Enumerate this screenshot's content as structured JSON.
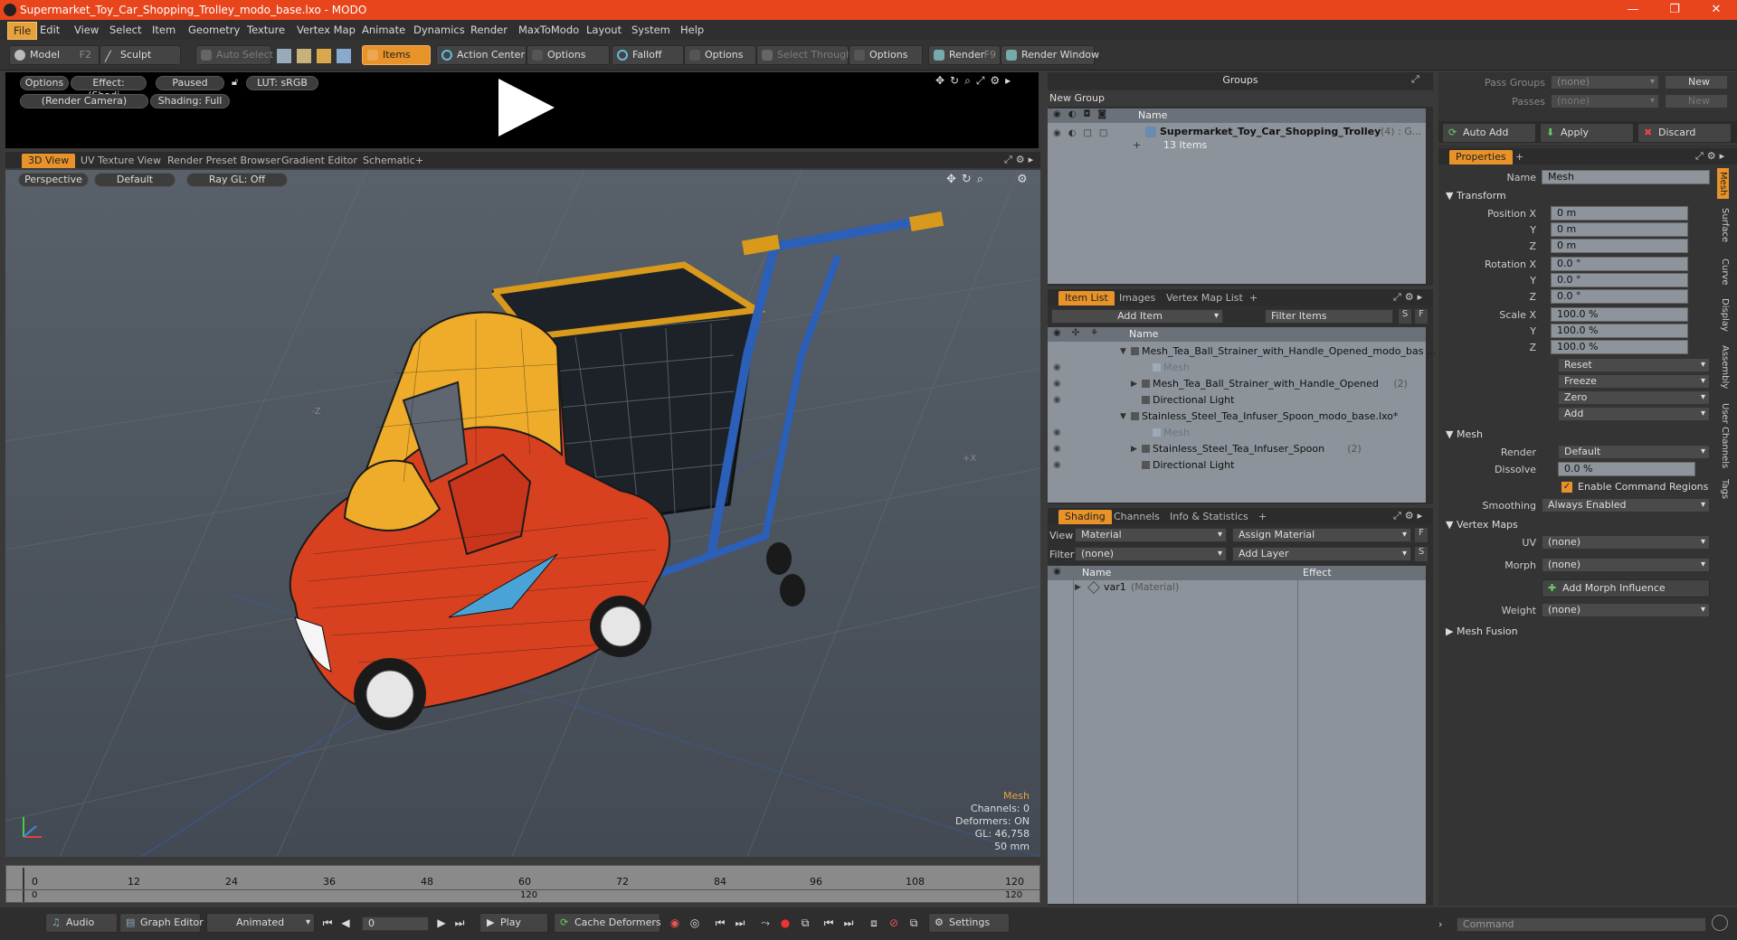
{
  "window": {
    "title": "Supermarket_Toy_Car_Shopping_Trolley_modo_base.lxo - MODO"
  },
  "menu": [
    "File",
    "Edit",
    "View",
    "Select",
    "Item",
    "Geometry",
    "Texture",
    "Vertex Map",
    "Animate",
    "Dynamics",
    "Render",
    "MaxToModo",
    "Layout",
    "System",
    "Help"
  ],
  "toolbar": {
    "model": "Model",
    "model_key": "F2",
    "sculpt": "Sculpt",
    "auto_select": "Auto Select",
    "items": "Items",
    "action_center": "Action Center",
    "options1": "Options",
    "falloff": "Falloff",
    "options2": "Options",
    "select_through": "Select Through",
    "options3": "Options",
    "render": "Render",
    "render_key": "F9",
    "render_window": "Render Window"
  },
  "preview": {
    "options": "Options",
    "effect": "Effect: (Shadi...",
    "paused": "Paused",
    "lut": "LUT: sRGB",
    "camera": "(Render Camera)",
    "shading": "Shading: Full"
  },
  "viewtabs": [
    "3D View",
    "UV Texture View",
    "Render Preset Browser",
    "Gradient Editor",
    "Schematic",
    "+"
  ],
  "viewport": {
    "perspective": "Perspective",
    "default": "Default",
    "raygl": "Ray GL: Off",
    "axis_z": "-Z",
    "axis_x": "+X",
    "info": {
      "mesh": "Mesh",
      "channels": "Channels: 0",
      "deformers": "Deformers: ON",
      "gl": "GL: 46,758",
      "size": "50 mm"
    }
  },
  "timeline": {
    "labels": [
      "0",
      "12",
      "24",
      "36",
      "48",
      "60",
      "72",
      "84",
      "96",
      "108",
      "120"
    ],
    "bottom_left": "0",
    "bottom_mid": "120",
    "bottom_right": "120"
  },
  "statusbar": {
    "audio": "Audio",
    "graph_editor": "Graph Editor",
    "animated": "Animated",
    "frame": "0",
    "play": "Play",
    "cache": "Cache Deformers",
    "settings": "Settings",
    "command": "Command"
  },
  "groups": {
    "title": "Groups",
    "new_group": "New Group",
    "col_name": "Name",
    "item_name": "Supermarket_Toy_Car_Shopping_Trolley",
    "item_count": "(4) : G...",
    "item_sub": "13 Items"
  },
  "itemlist": {
    "tabs": [
      "Item List",
      "Images",
      "Vertex Map List",
      "+"
    ],
    "add_item": "Add Item",
    "filter": "Filter Items",
    "col_name": "Name",
    "rows": [
      {
        "text": "Mesh_Tea_Ball_Strainer_with_Handle_Opened_modo_bas ...",
        "indent": 0,
        "arrow": "▼",
        "dim": false
      },
      {
        "text": "Mesh",
        "indent": 2,
        "arrow": "",
        "dim": true
      },
      {
        "text": "Mesh_Tea_Ball_Strainer_with_Handle_Opened",
        "extra": "(2)",
        "indent": 1,
        "arrow": "▶",
        "dim": false
      },
      {
        "text": "Directional Light",
        "indent": 1,
        "arrow": "",
        "dim": false
      },
      {
        "text": "Stainless_Steel_Tea_Infuser_Spoon_modo_base.lxo*",
        "indent": 0,
        "arrow": "▼",
        "dim": false
      },
      {
        "text": "Mesh",
        "indent": 2,
        "arrow": "",
        "dim": true
      },
      {
        "text": "Stainless_Steel_Tea_Infuser_Spoon",
        "extra": "(2)",
        "indent": 1,
        "arrow": "▶",
        "dim": false
      },
      {
        "text": "Directional Light",
        "indent": 1,
        "arrow": "",
        "dim": false
      }
    ]
  },
  "shading": {
    "tabs": [
      "Shading",
      "Channels",
      "Info & Statistics",
      "+"
    ],
    "view_label": "View",
    "view_value": "Material",
    "assign": "Assign Material",
    "filter_label": "Filter",
    "filter_value": "(none)",
    "add_layer": "Add Layer",
    "col_name": "Name",
    "col_effect": "Effect",
    "row_name": "var1",
    "row_type": "(Material)"
  },
  "passes": {
    "pass_groups": "Pass Groups",
    "passes": "Passes",
    "none1": "(none)",
    "none2": "(none)",
    "new1": "New",
    "new2": "New"
  },
  "actions": {
    "auto_add": "Auto Add",
    "apply": "Apply",
    "discard": "Discard"
  },
  "properties": {
    "tab": "Properties",
    "plus": "+",
    "name_label": "Name",
    "name_value": "Mesh",
    "transform": "Transform",
    "pos_label": "Position X",
    "rot_label": "Rotation X",
    "scale_label": "Scale X",
    "y": "Y",
    "z": "Z",
    "pos": [
      "0 m",
      "0 m",
      "0 m"
    ],
    "rot": [
      "0.0 °",
      "0.0 °",
      "0.0 °"
    ],
    "scale": [
      "100.0 %",
      "100.0 %",
      "100.0 %"
    ],
    "reset": "Reset",
    "freeze": "Freeze",
    "zero": "Zero",
    "add": "Add",
    "mesh": "Mesh",
    "render_label": "Render",
    "render_value": "Default",
    "dissolve_label": "Dissolve",
    "dissolve_value": "0.0 %",
    "enable_cmd": "Enable Command Regions",
    "smoothing_label": "Smoothing",
    "smoothing_value": "Always Enabled",
    "vertex_maps": "Vertex Maps",
    "uv_label": "UV",
    "uv_value": "(none)",
    "morph_label": "Morph",
    "morph_value": "(none)",
    "add_morph": "Add Morph Influence",
    "weight_label": "Weight",
    "weight_value": "(none)",
    "mesh_fusion": "Mesh Fusion",
    "side_tabs": [
      "Mesh",
      "Surface",
      "Curve",
      "Display",
      "Assembly",
      "User Channels",
      "Tags"
    ]
  },
  "colors": {
    "accent": "#e8922a",
    "title": "#e8451c"
  }
}
